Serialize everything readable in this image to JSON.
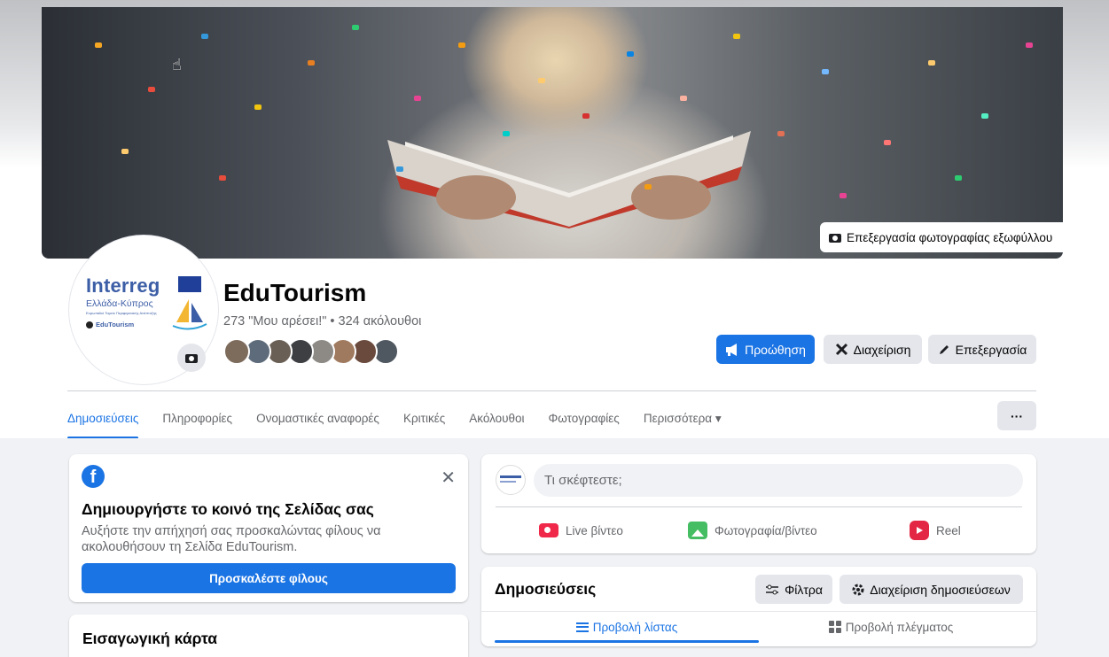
{
  "cover": {
    "edit_cover_label": "Επεξεργασία φωτογραφίας εξωφύλλου"
  },
  "profile": {
    "logo_brand": "Interreg",
    "logo_region": "Ελλάδα-Κύπρος",
    "logo_tagline": "Ευρωπαϊκό Ταμείο Περιφερειακής Ανάπτυξης",
    "logo_project": "EduTourism",
    "page_name": "EduTourism",
    "stats": "273 \"Μου αρέσει!\" • 324 ακόλουθοι",
    "friend_avatar_colors": [
      "#7d6b5c",
      "#5e6b7a",
      "#6a5f55",
      "#3d3f42",
      "#8d8a86",
      "#a07a5f",
      "#6a4a3d",
      "#4f5760"
    ]
  },
  "actions": {
    "promote_label": "Προώθηση",
    "manage_label": "Διαχείριση",
    "edit_label": "Επεξεργασία"
  },
  "tabs": {
    "items": [
      "Δημοσιεύσεις",
      "Πληροφορίες",
      "Ονομαστικές αναφορές",
      "Κριτικές",
      "Ακόλουθοι",
      "Φωτογραφίες",
      "Περισσότερα ▾"
    ],
    "more_btn": "···"
  },
  "promo": {
    "title": "Δημιουργήστε το κοινό της Σελίδας σας",
    "text": "Αυξήστε την απήχησή σας προσκαλώντας φίλους να ακολουθήσουν τη Σελίδα EduTourism.",
    "button": "Προσκαλέστε φίλους"
  },
  "intro": {
    "title": "Εισαγωγική κάρτα"
  },
  "composer": {
    "placeholder": "Τι σκέφτεστε;",
    "live_label": "Live βίντεο",
    "photo_label": "Φωτογραφία/βίντεο",
    "reel_label": "Reel"
  },
  "posts": {
    "title": "Δημοσιεύσεις",
    "filters_label": "Φίλτρα",
    "manage_posts_label": "Διαχείριση δημοσιεύσεων",
    "list_view_label": "Προβολή λίστας",
    "grid_view_label": "Προβολή πλέγματος"
  },
  "colors": {
    "accent": "#1b74e4",
    "feed_bg": "#f0f2f5"
  }
}
